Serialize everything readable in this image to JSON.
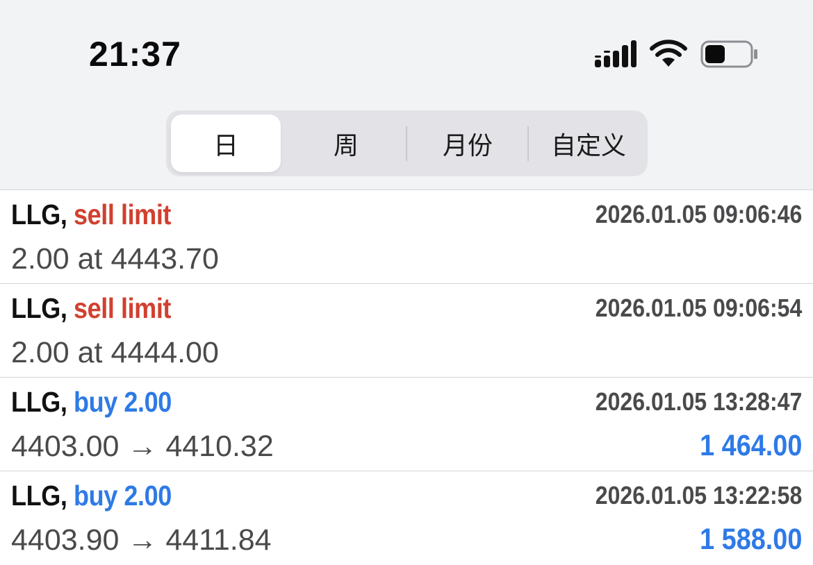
{
  "status_bar": {
    "time": "21:37",
    "icons": [
      "cellular-signal-icon",
      "wifi-icon",
      "battery-icon"
    ]
  },
  "period_tabs": [
    {
      "label": "日",
      "active": true
    },
    {
      "label": "周",
      "active": false
    },
    {
      "label": "月份",
      "active": false
    },
    {
      "label": "自定义",
      "active": false
    }
  ],
  "colors": {
    "sell": "#d1402f",
    "buy": "#2e7ae6",
    "profit": "#2e7ae6"
  },
  "orders": [
    {
      "symbol": "LLG,",
      "type": "sell limit",
      "side": "sell",
      "datetime": "2026.01.05 09:06:46",
      "detail": "2.00 at 4443.70",
      "profit": ""
    },
    {
      "symbol": "LLG,",
      "type": "sell limit",
      "side": "sell",
      "datetime": "2026.01.05 09:06:54",
      "detail": "2.00 at 4444.00",
      "profit": ""
    },
    {
      "symbol": "LLG,",
      "type": "buy 2.00",
      "side": "buy",
      "datetime": "2026.01.05 13:28:47",
      "detail": "4403.00 → 4410.32",
      "profit": "1 464.00"
    },
    {
      "symbol": "LLG,",
      "type": "buy 2.00",
      "side": "buy",
      "datetime": "2026.01.05 13:22:58",
      "detail": "4403.90 → 4411.84",
      "profit": "1 588.00"
    }
  ]
}
